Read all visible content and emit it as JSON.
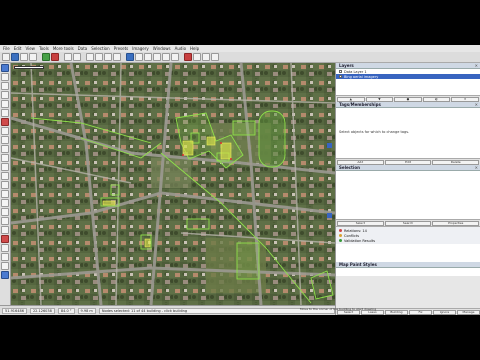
{
  "menu": [
    "File",
    "Edit",
    "View",
    "Tools",
    "More tools",
    "Data",
    "Selection",
    "Presets",
    "Imagery",
    "Windows",
    "Audio",
    "Help"
  ],
  "layers_panel": {
    "title": "Layers",
    "items": [
      {
        "label": "Data Layer 1",
        "selected": false
      },
      {
        "label": "Bing aerial imagery",
        "selected": true
      }
    ]
  },
  "tags_panel": {
    "title": "Tags/Memberships",
    "hint": "Select objects for which to change tags.",
    "buttons": [
      "Add",
      "Edit",
      "Delete"
    ]
  },
  "selection_panel": {
    "title": "Selection",
    "buttons": [
      "Select",
      "Search",
      "Properties"
    ]
  },
  "relations_list": [
    {
      "label": "Relations: 14"
    },
    {
      "label": "Conflicts"
    },
    {
      "label": "Validation Results"
    }
  ],
  "map_paint_panel": {
    "title": "Map Paint Styles"
  },
  "bottom_tabs": [
    "Select",
    "Lasso",
    "Building",
    "Fix",
    "Ignore",
    "Manage"
  ],
  "status": {
    "lat": "51.916486",
    "lon": "22.126038",
    "heading": "84.0 °",
    "length": "9.98 m",
    "message": "Nodes selected: 11 of 44 building - click building",
    "hint": "Move to the corner of the building to start drawing"
  },
  "colors": {
    "accent": "#3864c0",
    "map_green": "#8fe04a"
  }
}
